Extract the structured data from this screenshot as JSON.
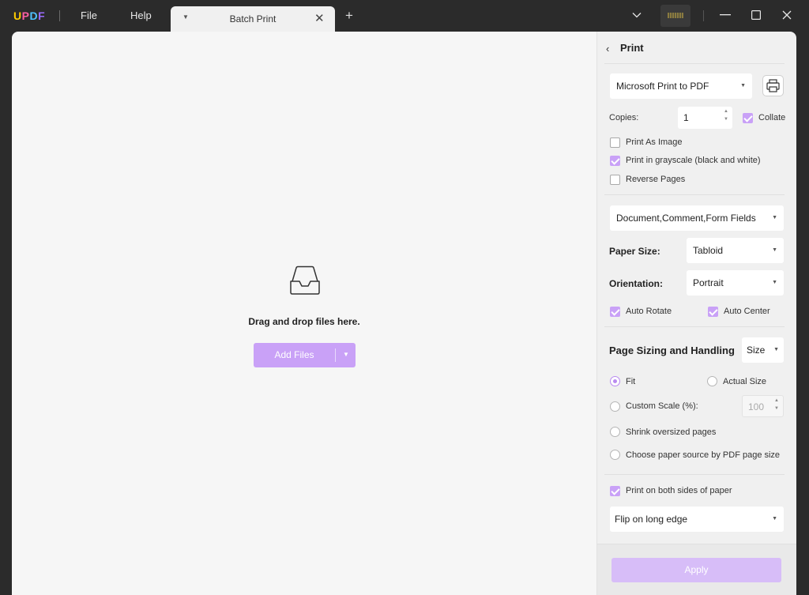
{
  "app": {
    "logo_letters": [
      "U",
      "P",
      "D",
      "F"
    ],
    "logo_colors": [
      "#ffcc00",
      "#ff5fa2",
      "#4fc3ff",
      "#9b6cff"
    ]
  },
  "menu": {
    "file": "File",
    "help": "Help"
  },
  "tab": {
    "title": "Batch Print"
  },
  "main": {
    "drop_text": "Drag and drop files here.",
    "add_files_label": "Add Files"
  },
  "panel": {
    "title": "Print",
    "printer": "Microsoft Print to PDF",
    "copies_label": "Copies:",
    "copies_value": "1",
    "collate": {
      "label": "Collate",
      "checked": true
    },
    "print_as_image": {
      "label": "Print As Image",
      "checked": false
    },
    "grayscale": {
      "label": "Print in grayscale (black and white)",
      "checked": true
    },
    "reverse_pages": {
      "label": "Reverse Pages",
      "checked": false
    },
    "content": "Document,Comment,Form Fields",
    "paper_size_label": "Paper Size:",
    "paper_size": "Tabloid",
    "orientation_label": "Orientation:",
    "orientation": "Portrait",
    "auto_rotate": {
      "label": "Auto Rotate",
      "checked": true
    },
    "auto_center": {
      "label": "Auto Center",
      "checked": true
    },
    "sizing_title": "Page Sizing and Handling",
    "sizing_mode": "Size",
    "fit": {
      "label": "Fit",
      "selected": true
    },
    "actual_size": {
      "label": "Actual Size",
      "selected": false
    },
    "custom_scale": {
      "label": "Custom Scale (%):",
      "selected": false,
      "value": "100"
    },
    "shrink": {
      "label": "Shrink oversized pages",
      "selected": false
    },
    "paper_source": {
      "label": "Choose paper source by PDF page size",
      "selected": false
    },
    "both_sides": {
      "label": "Print on both sides of paper",
      "checked": true
    },
    "flip": "Flip on long edge",
    "apply_label": "Apply"
  },
  "colors": {
    "accent": "#c9a1f7",
    "accent_disabled": "#d7bdf8",
    "titlebar": "#2b2b2b"
  }
}
